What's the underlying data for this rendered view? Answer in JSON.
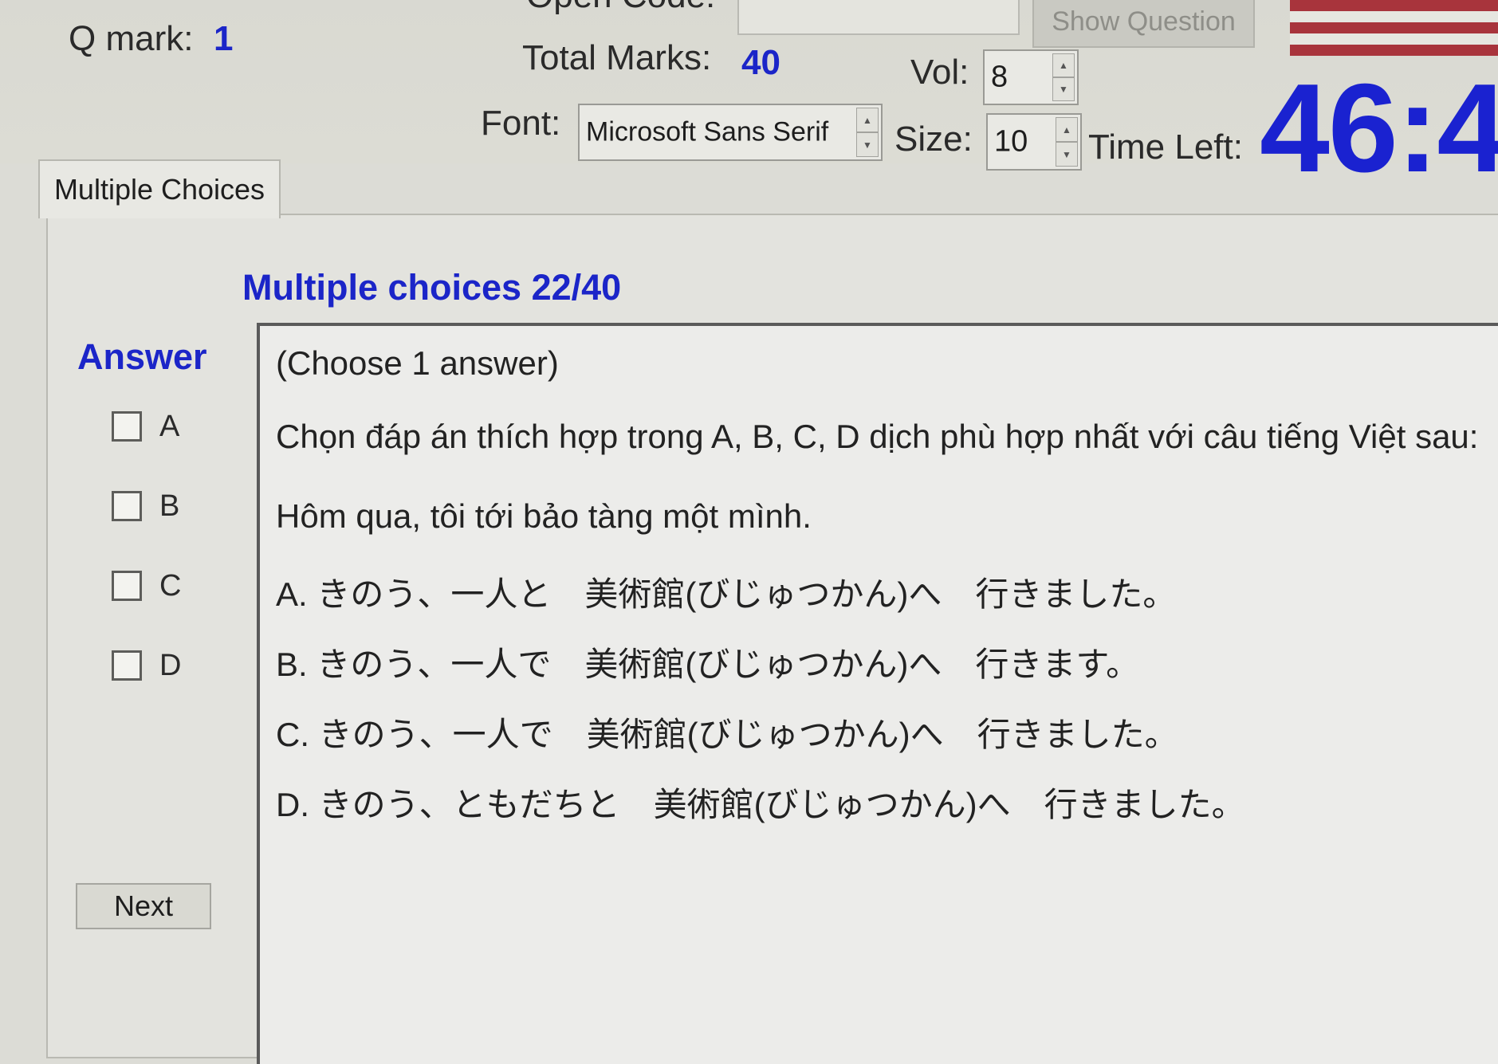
{
  "header": {
    "open_code_label": "Open Code:",
    "show_question_label": "Show Question",
    "q_mark_label": "Q mark:",
    "q_mark_value": "1",
    "total_marks_label": "Total Marks:",
    "total_marks_value": "40",
    "vol_label": "Vol:",
    "vol_value": "8",
    "font_label": "Font:",
    "font_value": "Microsoft Sans Serif",
    "size_label": "Size:",
    "size_value": "10",
    "time_left_label": "Time Left:",
    "time_left_value": "46:4"
  },
  "tabs": [
    {
      "label": "Multiple Choices"
    }
  ],
  "main": {
    "section_title": "Multiple choices 22/40",
    "answer_title": "Answer",
    "choices": [
      {
        "letter": "A",
        "checked": false
      },
      {
        "letter": "B",
        "checked": false
      },
      {
        "letter": "C",
        "checked": false
      },
      {
        "letter": "D",
        "checked": false
      }
    ],
    "next_label": "Next"
  },
  "question": {
    "instruction": "(Choose 1 answer)",
    "prompt": "Chọn đáp án thích hợp trong A, B, C, D dịch phù hợp nhất với câu tiếng Việt sau:",
    "sentence": "Hôm qua, tôi tới bảo tàng một mình.",
    "options": [
      "A. きのう、一人と　美術館(びじゅつかん)へ　行きました。",
      "B. きのう、一人で　美術館(びじゅつかん)へ　行きます。",
      "C. きのう、一人で　美術館(びじゅつかん)へ　行きました。",
      "D. きのう、ともだちと　美術館(びじゅつかん)へ　行きました。"
    ]
  },
  "colors": {
    "accent_blue": "#1b25c8",
    "flag_red": "#a8343c"
  }
}
